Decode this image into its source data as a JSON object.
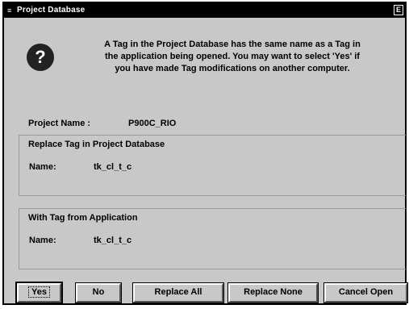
{
  "window": {
    "title": "Project Database",
    "system_menu_glyph": "≡",
    "close_glyph": "E"
  },
  "dialog": {
    "icon": "question-icon",
    "icon_glyph": "?",
    "message_line1": "A Tag in the Project Database has the same name as a Tag in",
    "message_line2": "the application being opened. You may want to select 'Yes' if",
    "message_line3": "you have made Tag modifications on another computer.",
    "project_name_label": "Project Name :",
    "project_name_value": "P900C_RIO"
  },
  "replace_group": {
    "title": "Replace Tag in Project Database",
    "name_label": "Name:",
    "name_value": "tk_cl_t_c"
  },
  "with_group": {
    "title": "With Tag from Application",
    "name_label": "Name:",
    "name_value": "tk_cl_t_c"
  },
  "buttons": {
    "yes": "Yes",
    "no": "No",
    "replace_all": "Replace All",
    "replace_none": "Replace None",
    "cancel_open": "Cancel Open"
  }
}
